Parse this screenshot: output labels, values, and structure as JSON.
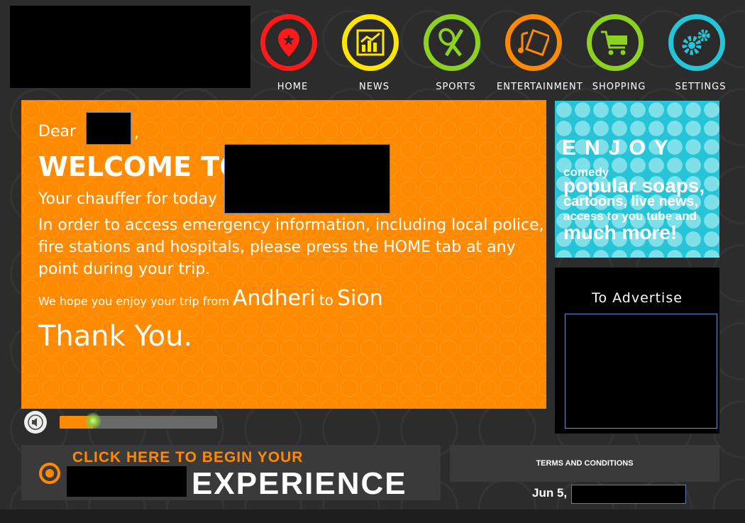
{
  "nav": {
    "items": [
      {
        "label": "HOME",
        "color": "#ff1a1a",
        "icon": "map-pin-icon"
      },
      {
        "label": "NEWS",
        "color": "#ffe600",
        "icon": "bar-chart-icon"
      },
      {
        "label": "SPORTS",
        "color": "#8cd21e",
        "icon": "tennis-racket-icon"
      },
      {
        "label": "ENTERTAINMENT",
        "color": "#ff8a00",
        "icon": "film-music-icon"
      },
      {
        "label": "SHOPPING",
        "color": "#8cd21e",
        "icon": "shopping-cart-icon"
      },
      {
        "label": "SETTINGS",
        "color": "#25c4d6",
        "icon": "gears-icon"
      }
    ]
  },
  "welcome": {
    "dear": "Dear",
    "comma": ",",
    "welcome_to": "WELCOME TO",
    "chauffer": "Your chauffer for today",
    "emergency": "In order to access emergency information, including local police,",
    "emergency2": "fire stations and hospitals, please press the HOME tab at any",
    "emergency3": "point during your trip.",
    "enjoy_prefix": "We hope you enjoy your trip from",
    "from_city": "Andheri",
    "to_word": "to",
    "to_city": "Sion",
    "thanks": "Thank You."
  },
  "enjoy_ad": {
    "letters": [
      "E",
      "N",
      "J",
      "O",
      "Y"
    ],
    "line1": "comedy",
    "line2": "popular soaps,",
    "line3": "cartoons, live news,",
    "line4": "access to you tube and",
    "line5": "much more!"
  },
  "advertise": {
    "title": "To Advertise"
  },
  "media": {
    "progress_percent": 21
  },
  "cta": {
    "line1": "CLICK HERE TO BEGIN YOUR",
    "line2": "EXPERIENCE"
  },
  "terms": {
    "label": "TERMS AND CONDITIONS"
  },
  "date": {
    "prefix": "Jun 5,"
  },
  "colors": {
    "accent_orange": "#ff8a00",
    "accent_cyan": "#25c4d6"
  }
}
